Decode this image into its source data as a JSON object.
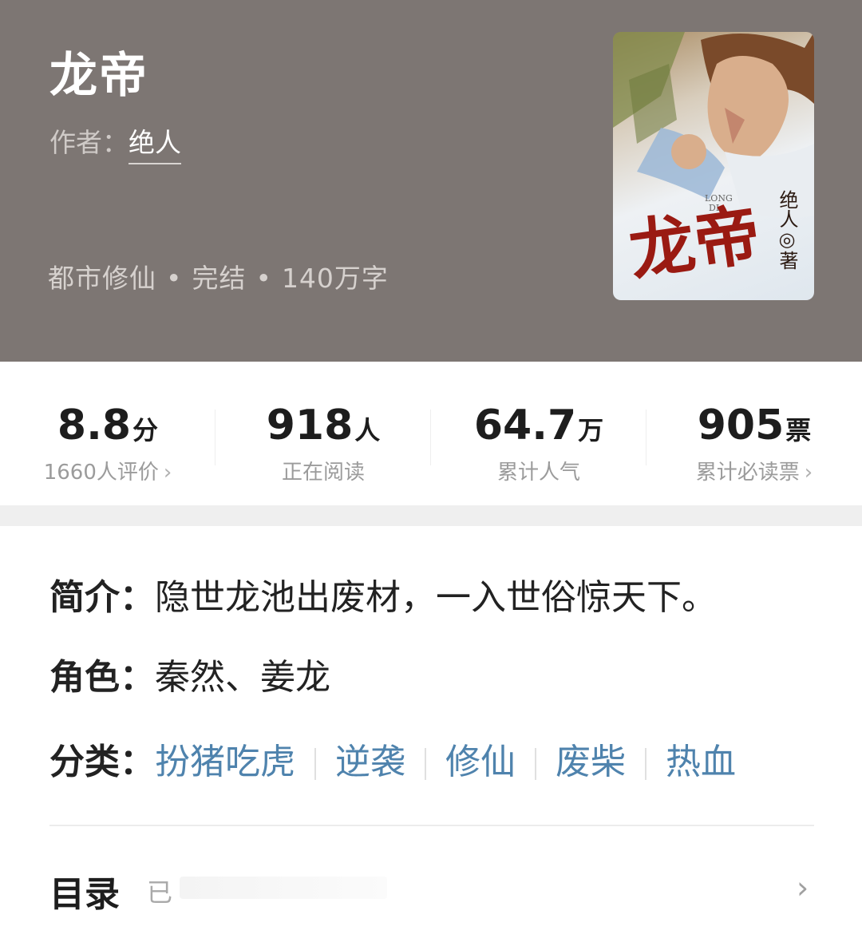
{
  "book": {
    "title": "龙帝",
    "author_label": "作者：",
    "author": "绝人",
    "genre": "都市修仙",
    "status": "完结",
    "word_count": "140万字",
    "dot": "•"
  },
  "cover": {
    "title": "龙帝",
    "pinyin_top": "LONG",
    "pinyin_bottom": "DI",
    "author_mark": "绝人◎著"
  },
  "stats": [
    {
      "value": "8.8",
      "unit": "分",
      "label": "1660人评价",
      "chevron": "›"
    },
    {
      "value": "918",
      "unit": "人",
      "label": "正在阅读"
    },
    {
      "value": "64.7",
      "unit": "万",
      "label": "累计人气"
    },
    {
      "value": "905",
      "unit": "票",
      "label": "累计必读票",
      "chevron": "›"
    }
  ],
  "intro": {
    "label": "简介：",
    "text": "隐世龙池出废材，一入世俗惊天下。"
  },
  "roles": {
    "label": "角色：",
    "text": "秦然、姜龙"
  },
  "tags": {
    "label": "分类：",
    "items": [
      "扮猪吃虎",
      "逆袭",
      "修仙",
      "废柴",
      "热血"
    ]
  },
  "toc": {
    "label": "目录",
    "sub": "已",
    "chevron": "›"
  },
  "colors": {
    "header_bg": "#7d7673",
    "tag": "#4f83ad",
    "cover_title": "#9a1a12"
  }
}
